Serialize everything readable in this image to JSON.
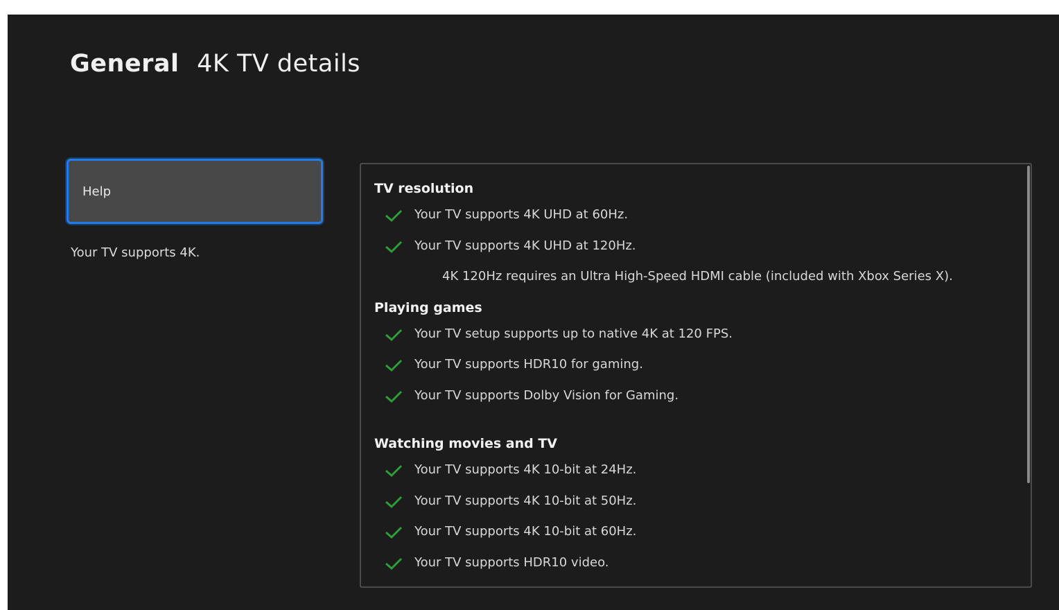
{
  "header": {
    "breadcrumb": "General",
    "title": "4K TV details"
  },
  "sidebar": {
    "help_label": "Help",
    "summary": "Your TV supports 4K."
  },
  "details": {
    "sections": [
      {
        "title": "TV resolution",
        "items": [
          "Your TV supports 4K UHD at 60Hz.",
          "Your TV supports 4K UHD at 120Hz."
        ],
        "note": "4K 120Hz requires an Ultra High-Speed HDMI cable (included with Xbox Series X)."
      },
      {
        "title": "Playing games",
        "items": [
          "Your TV setup supports up to native 4K at 120 FPS.",
          "Your TV supports HDR10 for gaming.",
          "Your TV supports Dolby Vision for Gaming."
        ]
      },
      {
        "title": "Watching movies and TV",
        "items": [
          "Your TV supports 4K 10-bit at 24Hz.",
          "Your TV supports 4K 10-bit at 50Hz.",
          "Your TV supports 4K 10-bit at 60Hz.",
          "Your TV supports HDR10 video."
        ]
      }
    ]
  },
  "colors": {
    "background": "#1c1c1c",
    "focus_outline": "#1f7ce8",
    "check": "#2e9e3a"
  },
  "icons": {
    "item_status": "check-icon"
  }
}
